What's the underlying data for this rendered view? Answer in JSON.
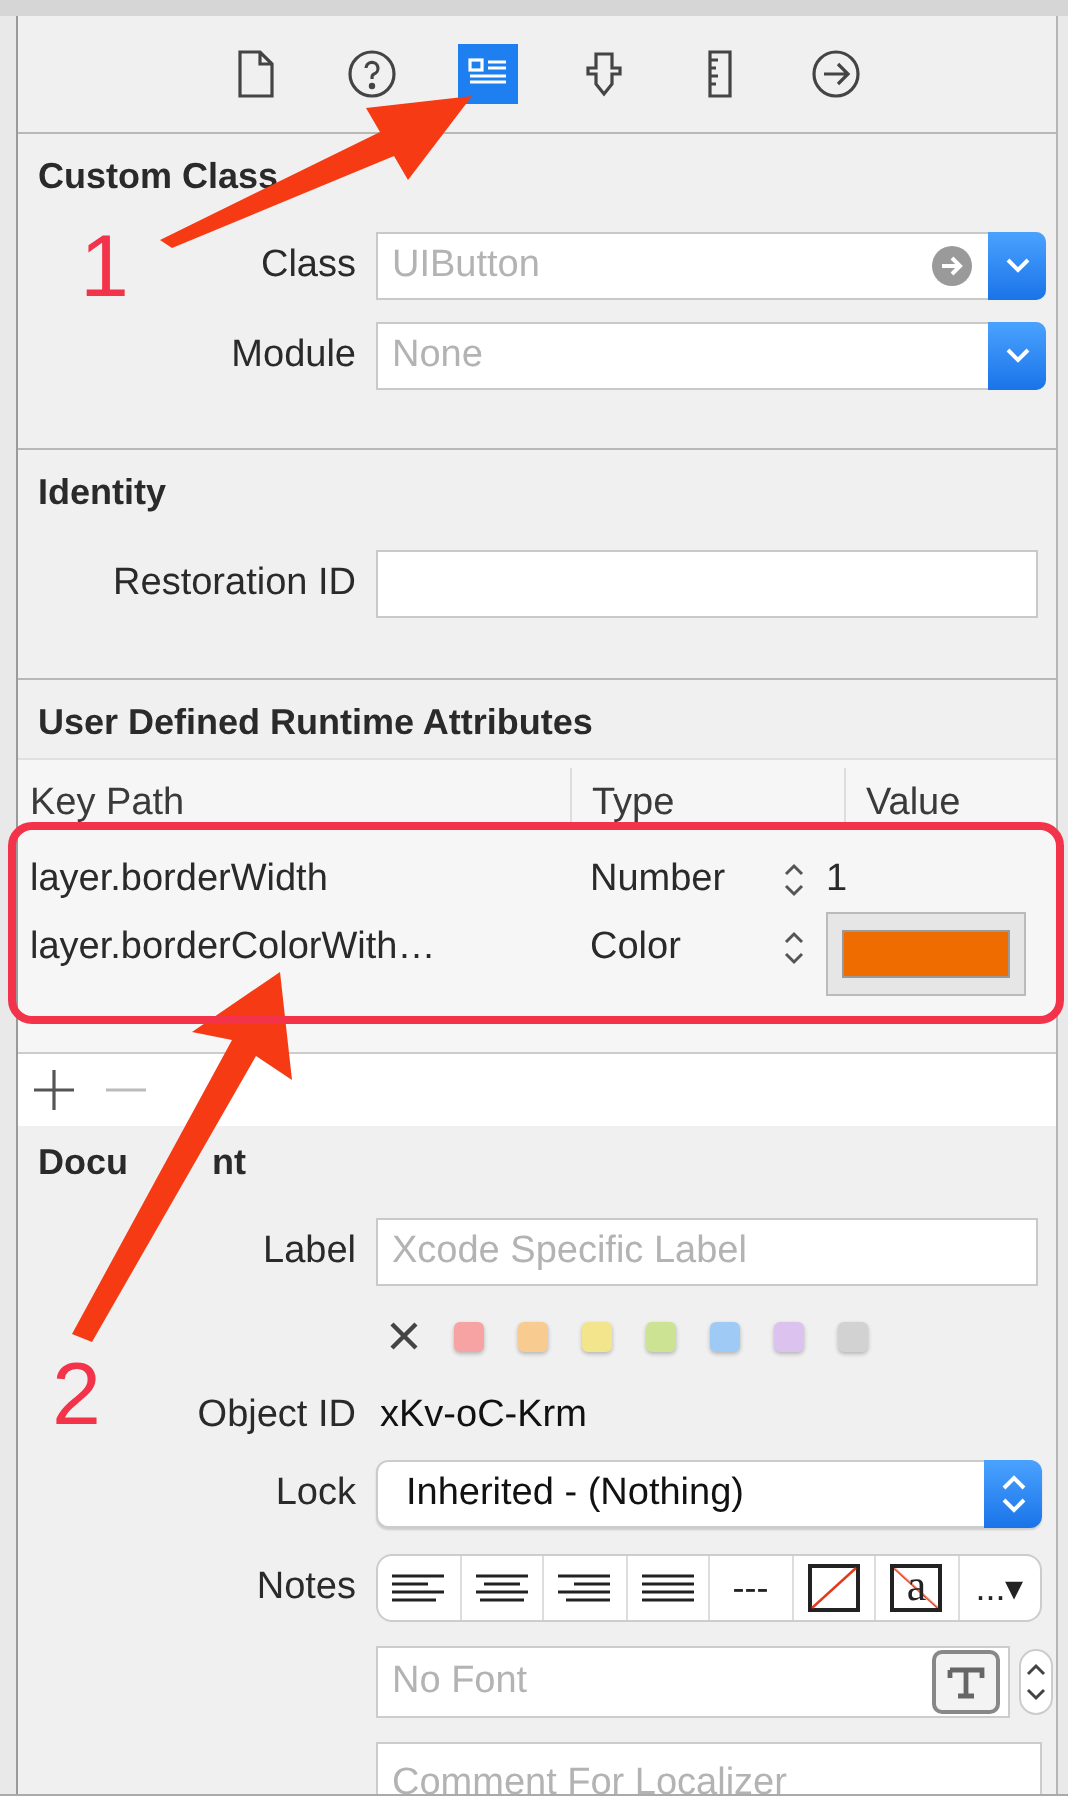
{
  "toolbar": [
    {
      "kind": "file",
      "selected": false
    },
    {
      "kind": "help",
      "selected": false
    },
    {
      "kind": "identity",
      "selected": true
    },
    {
      "kind": "attributes",
      "selected": false
    },
    {
      "kind": "size",
      "selected": false
    },
    {
      "kind": "connections",
      "selected": false
    }
  ],
  "custom_class": {
    "title": "Custom Class",
    "class_label": "Class",
    "class_placeholder": "UIButton",
    "module_label": "Module",
    "module_placeholder": "None"
  },
  "identity": {
    "title": "Identity",
    "restoration_label": "Restoration ID"
  },
  "runtime_attributes": {
    "title": "User Defined Runtime Attributes",
    "columns": [
      "Key Path",
      "Type",
      "Value"
    ],
    "rows": [
      {
        "key_path": "layer.borderWidth",
        "type": "Number",
        "kind": "number",
        "value": "1"
      },
      {
        "key_path": "layer.borderColorWith…",
        "type": "Color",
        "kind": "color",
        "color": "#ee6c00"
      }
    ]
  },
  "document": {
    "title_parts": [
      "Docu",
      "nt"
    ],
    "label_label": "Label",
    "label_placeholder": "Xcode Specific Label",
    "swatches": [
      {
        "color": "#f7a3a3"
      },
      {
        "color": "#f8cc90"
      },
      {
        "color": "#f3e58c"
      },
      {
        "color": "#cde394"
      },
      {
        "color": "#9fcaf6"
      },
      {
        "color": "#dcc2ee"
      },
      {
        "color": "#d2d2d2"
      }
    ],
    "object_id_label": "Object ID",
    "object_id": "xKv-oC-Krm",
    "lock_label": "Lock",
    "lock_value": "Inherited - (Nothing)",
    "notes_label": "Notes",
    "notes_tools": [
      {
        "kind": "align-left"
      },
      {
        "kind": "align-center"
      },
      {
        "kind": "align-right"
      },
      {
        "kind": "justify"
      },
      {
        "kind": "text",
        "text": "---"
      },
      {
        "kind": "no-color"
      },
      {
        "kind": "text-color",
        "text": "a"
      },
      {
        "kind": "text",
        "text": "...▾"
      }
    ],
    "font_placeholder": "No Font",
    "comment_placeholder": "Comment For Localizer"
  },
  "annotations": [
    {
      "number": "1"
    },
    {
      "number": "2"
    }
  ]
}
